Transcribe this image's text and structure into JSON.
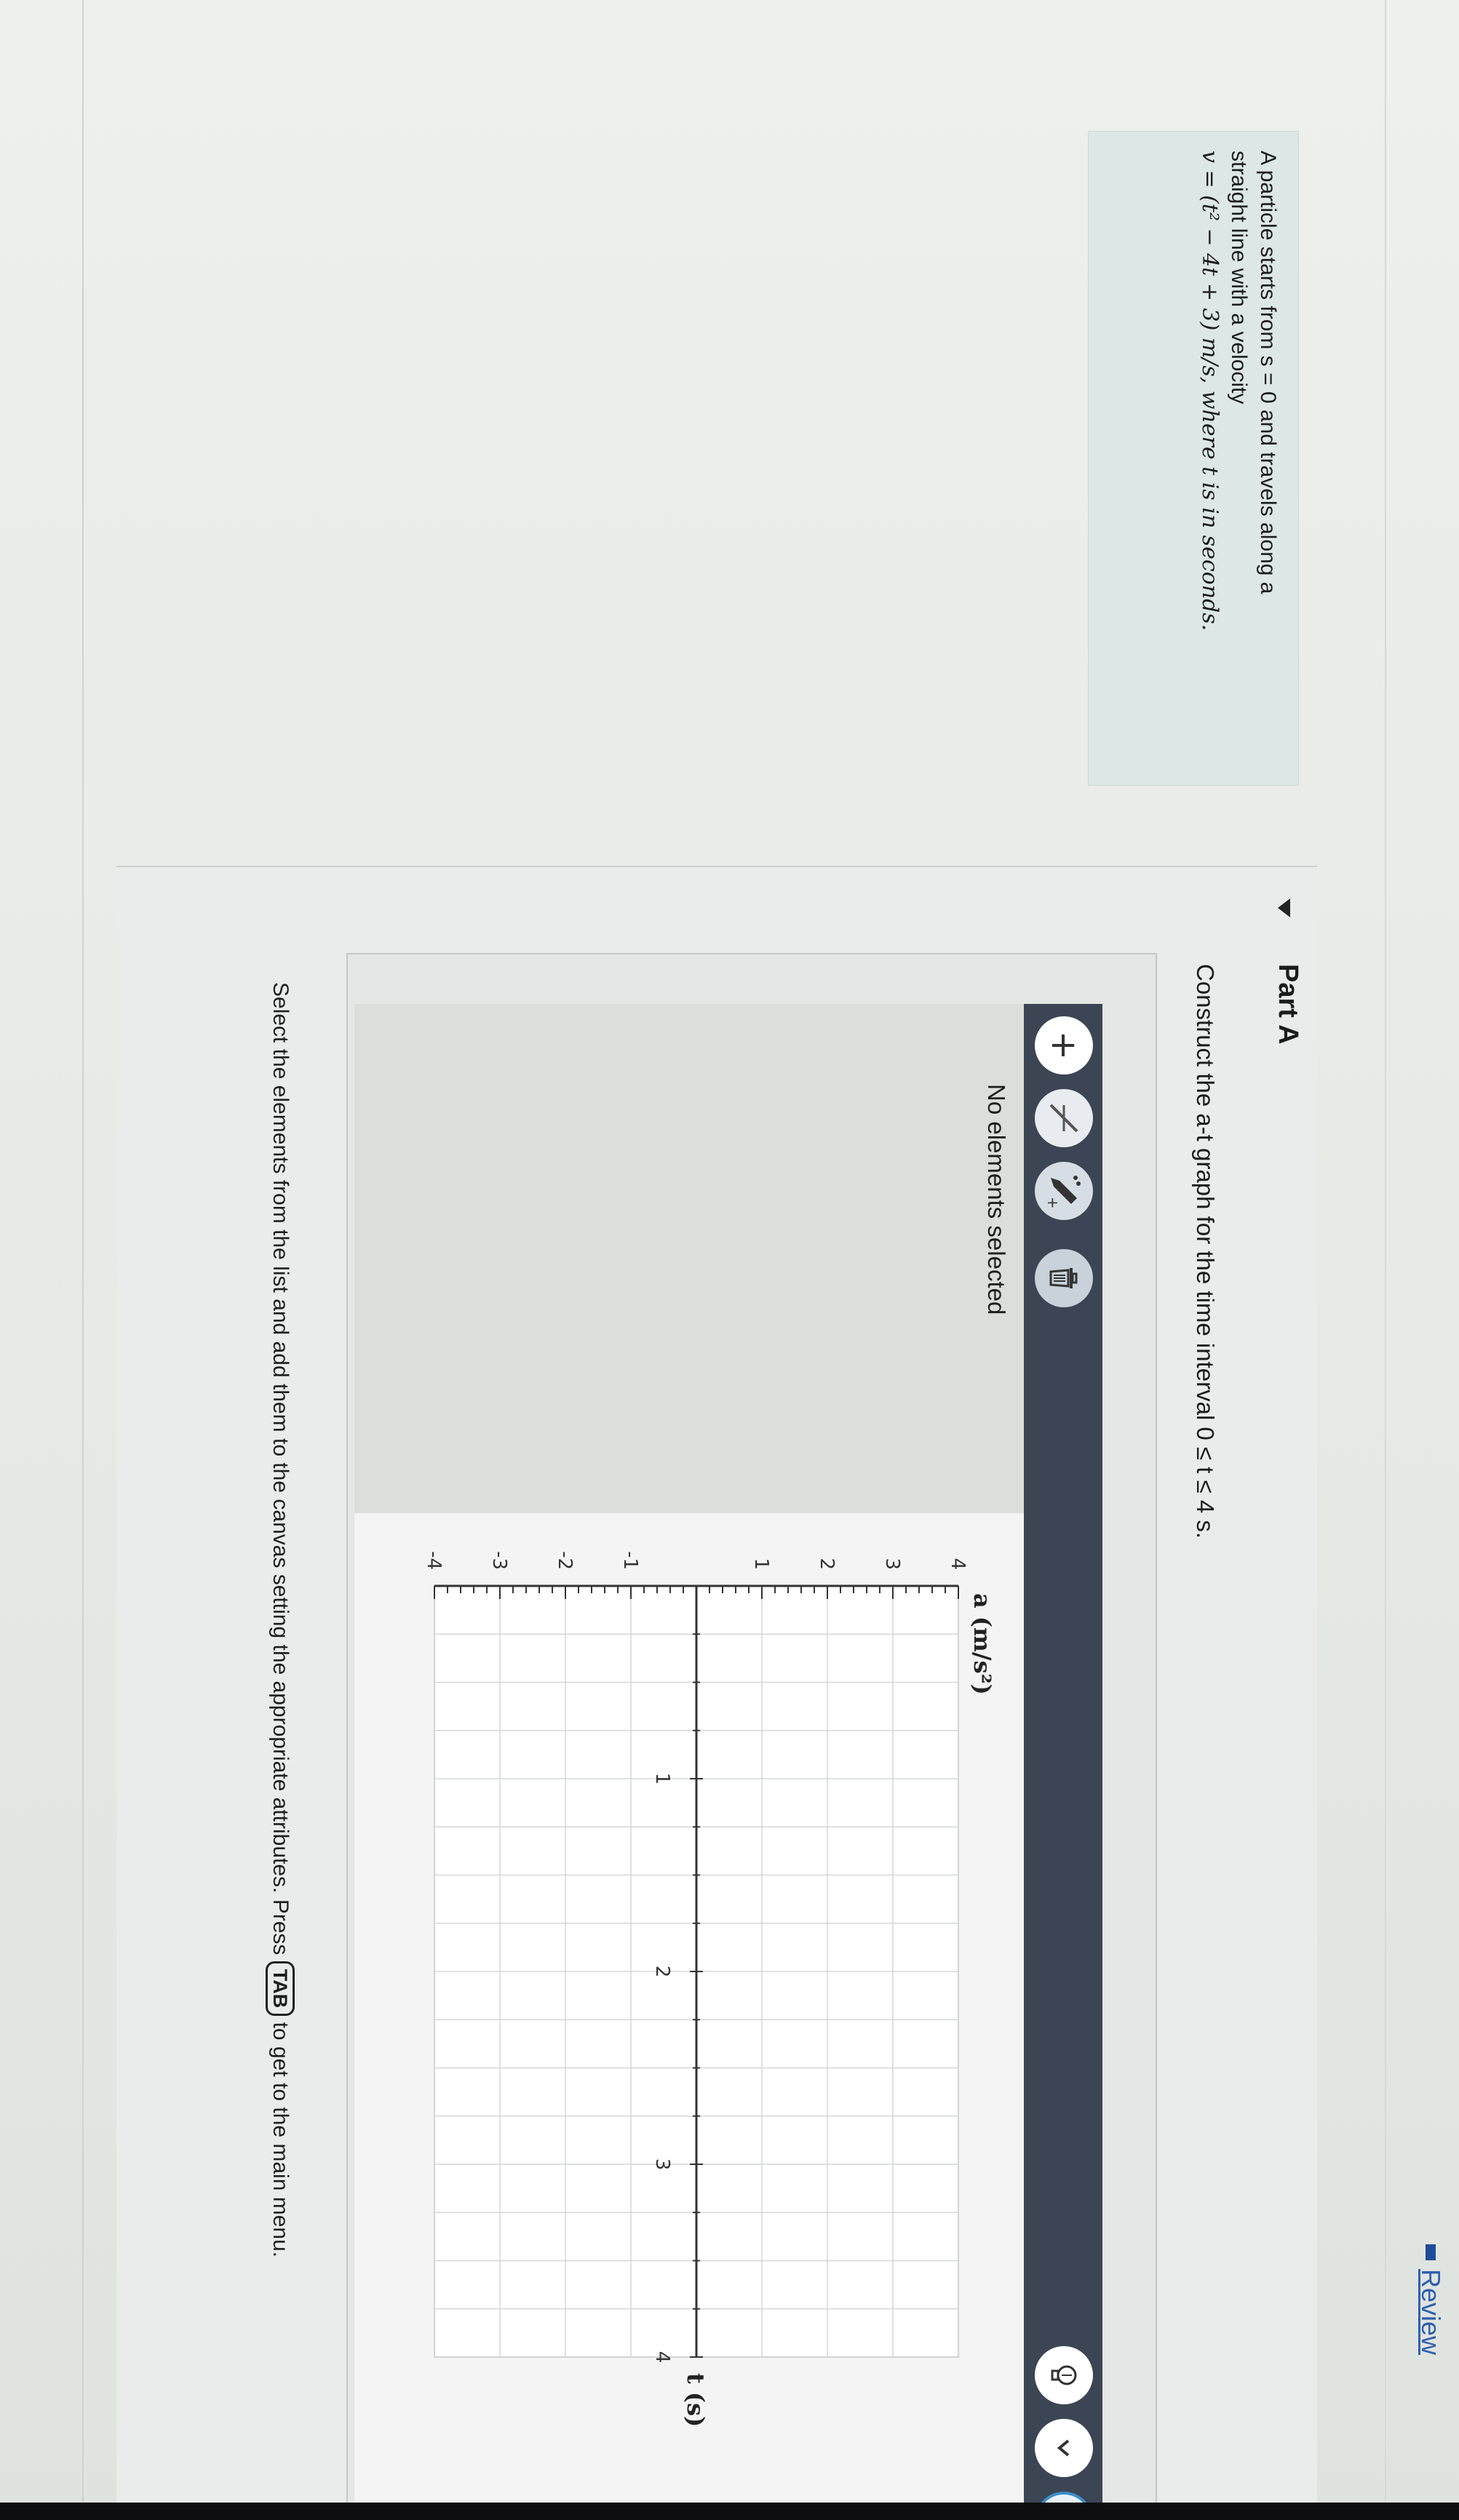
{
  "header": {
    "review_label": "Review"
  },
  "problem": {
    "line1": "A particle starts from s = 0 and travels along a",
    "line2": "straight line with a velocity",
    "line3": "v = (t² − 4t + 3) m/s, where t is in seconds."
  },
  "part_a": {
    "title": "Part A",
    "instruction": "Construct the a-t graph for the time interval 0 ≤ t ≤ 4 s."
  },
  "toolbar": {
    "add_icon": "plus-icon",
    "line_icon": "line-tool-icon",
    "pencil_icon": "pencil-plus-icon",
    "delete_icon": "trash-icon",
    "hint_icon": "lightbulb-icon",
    "chevron_icon": "chevron-down-icon",
    "reset_icon": "reset-icon",
    "help_label": "?"
  },
  "status": {
    "text": "No elements selected"
  },
  "graph": {
    "y_axis_label": "a (m/s²)",
    "x_axis_label": "t (s)",
    "x_ticks": [
      "1",
      "2",
      "3",
      "4"
    ],
    "y_ticks": [
      "4",
      "3",
      "2",
      "1",
      "-1",
      "-2",
      "-3",
      "-4"
    ],
    "x_range": [
      0,
      4
    ],
    "y_range": [
      -4,
      4
    ],
    "grid": true
  },
  "footer": {
    "instruction_before": "Select the elements from the list and add them to the canvas setting the appropriate attributes. Press",
    "tab_key": "TAB",
    "instruction_after": "to get to the main menu."
  },
  "colors": {
    "toolbar_bg": "#3c4553",
    "link": "#2d5fb0",
    "problem_bg": "#dde7e6",
    "reset_accent": "#3a8fc9"
  }
}
